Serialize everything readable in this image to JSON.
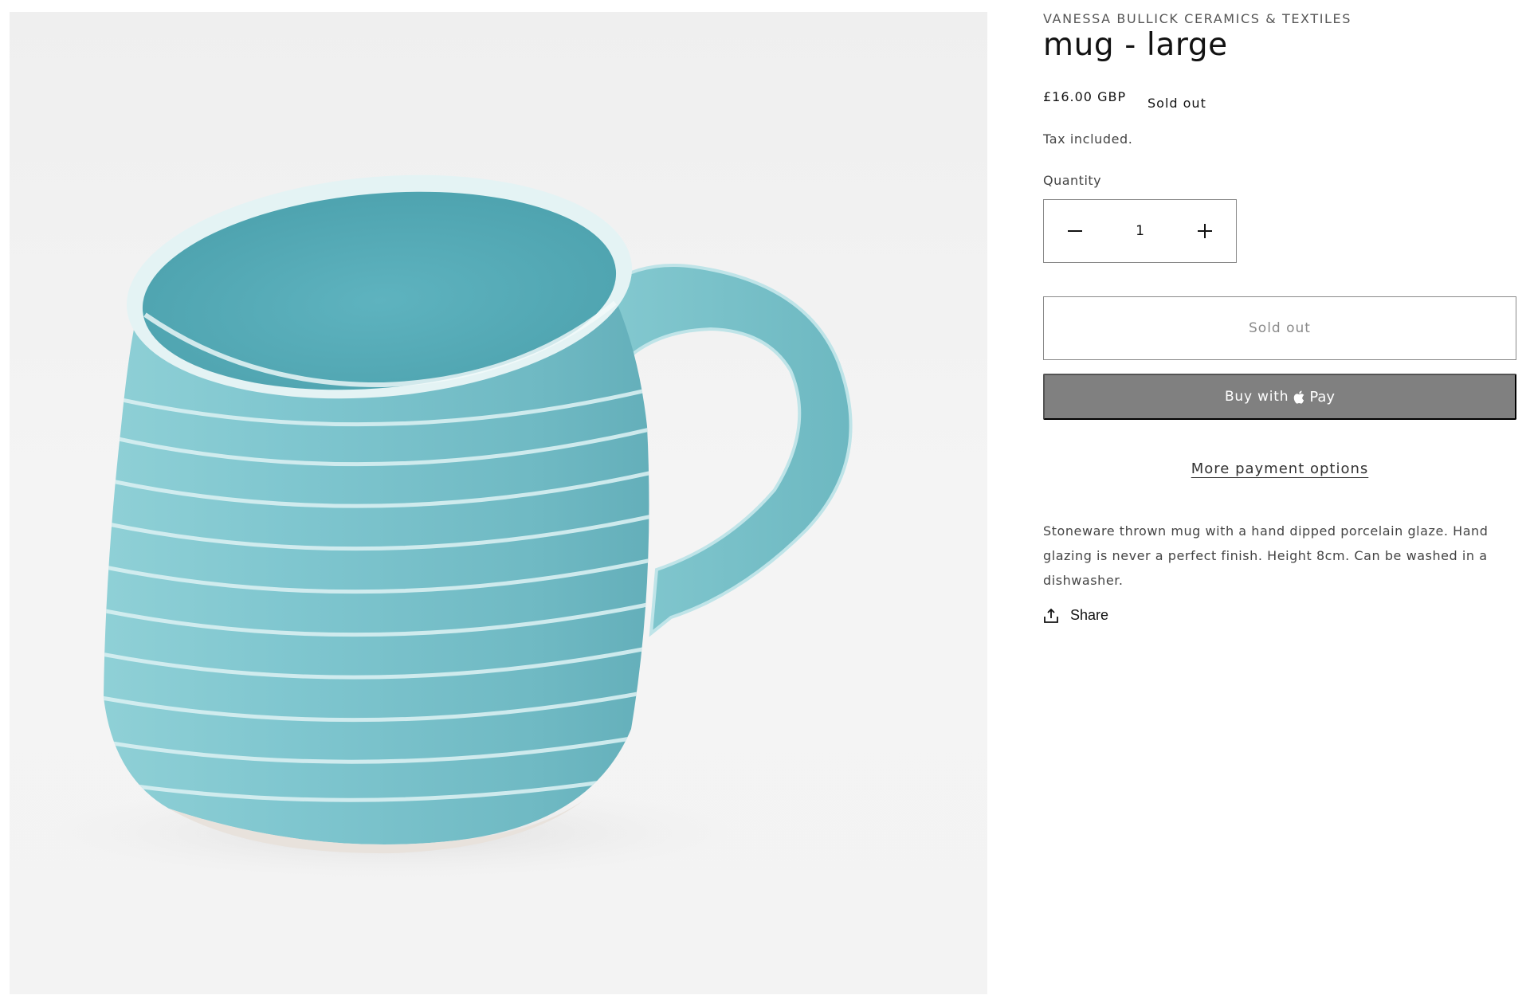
{
  "product": {
    "vendor": "VANESSA BULLICK CERAMICS & TEXTILES",
    "title": "mug - large",
    "price": "£16.00 GBP",
    "badge": "Sold out",
    "tax_note": "Tax included.",
    "image_subject": "glazed ribbed mug, turquoise"
  },
  "quantity": {
    "label": "Quantity",
    "value": "1",
    "decrease_icon": "minus-icon",
    "increase_icon": "plus-icon"
  },
  "buttons": {
    "add_to_cart_label": "Sold out",
    "apple_pay_prefix": "Buy with",
    "apple_pay_brand": "Pay",
    "more_payment_options": "More payment options"
  },
  "description": "Stoneware thrown mug with a hand dipped porcelain glaze. Hand glazing is never a perfect finish. Height 8cm. Can be washed in a dishwasher.",
  "share": {
    "label": "Share",
    "icon": "share-icon"
  },
  "colors": {
    "apple_pay_bg": "#808080",
    "mug_glaze": "#7ec8d0",
    "text_primary": "#121212",
    "text_secondary": "#444444"
  }
}
